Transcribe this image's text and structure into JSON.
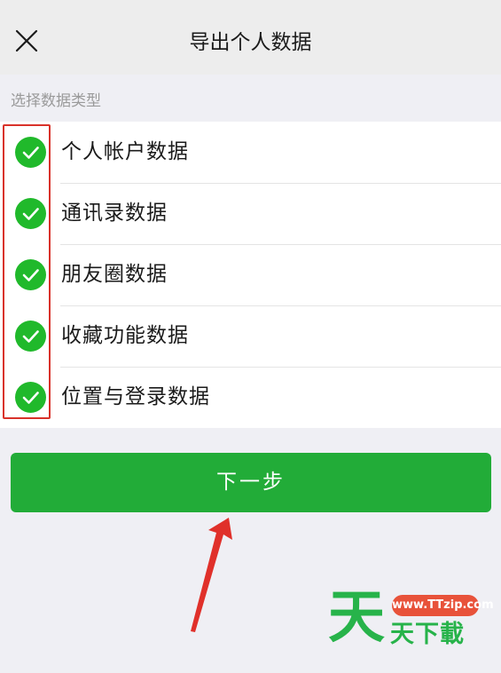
{
  "header": {
    "close_icon": "close-icon",
    "title": "导出个人数据"
  },
  "section": {
    "label": "选择数据类型"
  },
  "options": [
    {
      "label": "个人帐户数据",
      "checked": true
    },
    {
      "label": "通讯录数据",
      "checked": true
    },
    {
      "label": "朋友圈数据",
      "checked": true
    },
    {
      "label": "收藏功能数据",
      "checked": true
    },
    {
      "label": "位置与登录数据",
      "checked": true
    }
  ],
  "footer": {
    "next_label": "下一步"
  },
  "watermark": {
    "big_char": "天",
    "url": "www.TTzip.com",
    "text": "天下載"
  },
  "colors": {
    "accent_green": "#22ac38",
    "check_green": "#20b92b",
    "annotation_red": "#d9322a",
    "background": "#efeff4"
  }
}
